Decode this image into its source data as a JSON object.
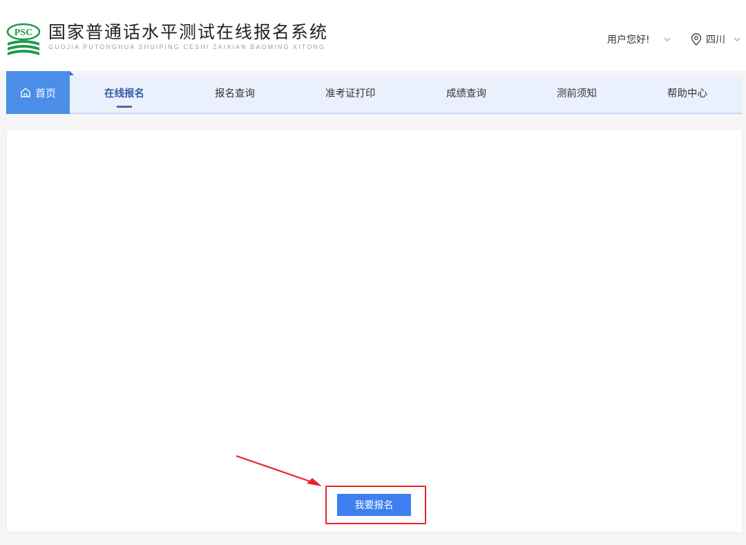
{
  "header": {
    "logo_badge": "PSC",
    "title": "国家普通话水平测试在线报名系统",
    "subtitle": "GUOJIA PUTONGHUA SHUIPING CESHI ZAIXIAN BAOMING XITONG",
    "user_greeting": "用户您好!",
    "location": "四川"
  },
  "nav": {
    "home_label": "首页",
    "items": [
      {
        "label": "在线报名",
        "active": true
      },
      {
        "label": "报名查询"
      },
      {
        "label": "准考证打印"
      },
      {
        "label": "成绩查询"
      },
      {
        "label": "测前须知"
      },
      {
        "label": "帮助中心"
      }
    ]
  },
  "main": {
    "apply_button": "我要报名"
  },
  "colors": {
    "brand_green": "#1e9b4a",
    "nav_active_blue": "#4a8ee8",
    "button_blue": "#3d7ff0",
    "annotation_red": "#e8232a"
  },
  "icons": [
    "psc-logo",
    "home-icon",
    "chevron-down-icon",
    "location-pin-icon",
    "annotation-arrow"
  ]
}
